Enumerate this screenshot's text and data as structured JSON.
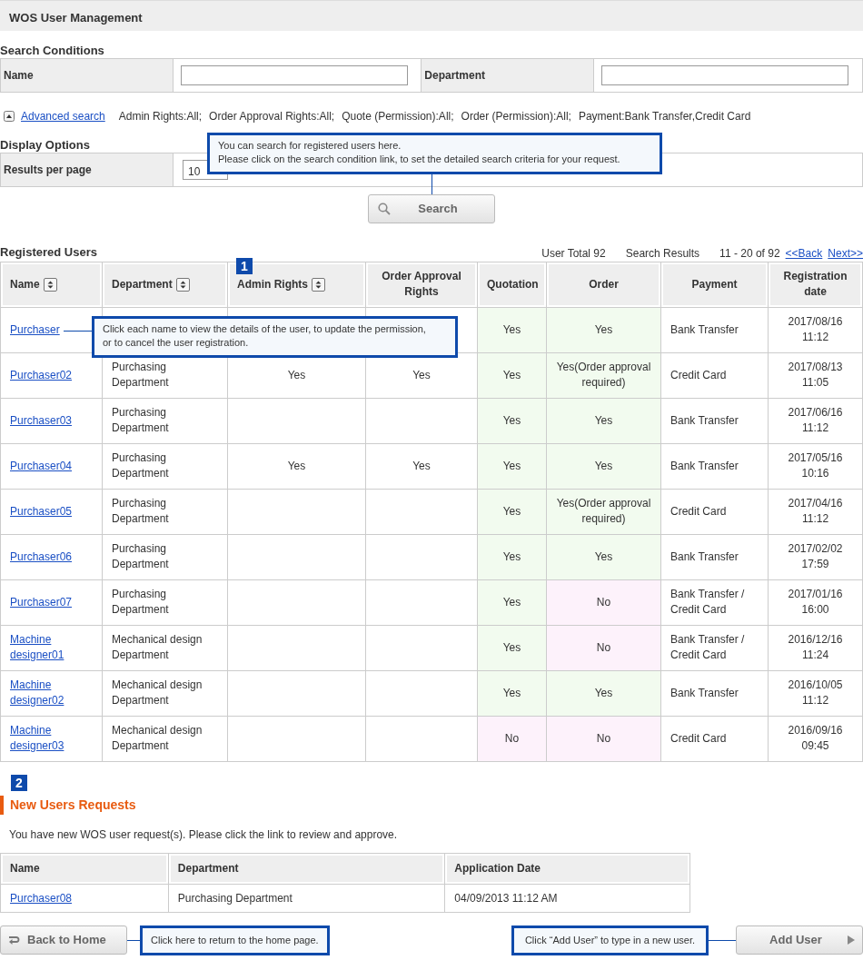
{
  "page_title": "WOS User Management",
  "search": {
    "heading": "Search Conditions",
    "fields": [
      {
        "label": "Name"
      },
      {
        "label": "Department"
      }
    ],
    "advanced_link": "Advanced search",
    "expanded": true,
    "criteria": [
      "Admin Rights:All;",
      "Order Approval Rights:All;",
      "Quote (Permission):All;",
      "Order (Permission):All;",
      "Payment:Bank Transfer,Credit Card"
    ]
  },
  "display_options": {
    "heading": "Display Options",
    "label": "Results per page",
    "value": "10"
  },
  "search_button": "Search",
  "search_callout": [
    "You can search for registered users here.",
    "Please click on the search condition link, to set the detailed search criteria for your request."
  ],
  "users": {
    "heading": "Registered Users",
    "total": "User Total 92",
    "results_label": "Search Results",
    "range": "11 - 20 of 92",
    "prev": "<<Back",
    "next": "Next>>",
    "marker": "1",
    "columns": [
      {
        "label": "Name",
        "sortable": true
      },
      {
        "label": "Department",
        "sortable": true
      },
      {
        "label": "Admin Rights",
        "sortable": true
      },
      {
        "label": "Order Approval Rights",
        "sortable": false
      },
      {
        "label": "Quotation",
        "sortable": false
      },
      {
        "label": "Order",
        "sortable": false
      },
      {
        "label": "Payment",
        "sortable": false
      },
      {
        "label": "Registration date",
        "sortable": false
      }
    ],
    "rows": [
      {
        "name": "Purchaser",
        "department": "",
        "admin": "",
        "approval": "",
        "quotation": {
          "text": "Yes",
          "granted": true
        },
        "order": {
          "text": "Yes",
          "granted": true
        },
        "payment": "Bank Transfer",
        "date": "2017/08/16 11:12"
      },
      {
        "name": "Purchaser02",
        "department": "Purchasing Department",
        "admin": "Yes",
        "approval": "Yes",
        "quotation": {
          "text": "Yes",
          "granted": true
        },
        "order": {
          "text": "Yes(Order approval required)",
          "granted": true
        },
        "payment": "Credit Card",
        "date": "2017/08/13 11:05"
      },
      {
        "name": "Purchaser03",
        "department": "Purchasing Department",
        "admin": "",
        "approval": "",
        "quotation": {
          "text": "Yes",
          "granted": true
        },
        "order": {
          "text": "Yes",
          "granted": true
        },
        "payment": "Bank Transfer",
        "date": "2017/06/16 11:12"
      },
      {
        "name": "Purchaser04",
        "department": "Purchasing Department",
        "admin": "Yes",
        "approval": "Yes",
        "quotation": {
          "text": "Yes",
          "granted": true
        },
        "order": {
          "text": "Yes",
          "granted": true
        },
        "payment": "Bank Transfer",
        "date": "2017/05/16 10:16"
      },
      {
        "name": "Purchaser05",
        "department": "Purchasing Department",
        "admin": "",
        "approval": "",
        "quotation": {
          "text": "Yes",
          "granted": true
        },
        "order": {
          "text": "Yes(Order approval required)",
          "granted": true
        },
        "payment": "Credit Card",
        "date": "2017/04/16 11:12"
      },
      {
        "name": "Purchaser06",
        "department": "Purchasing Department",
        "admin": "",
        "approval": "",
        "quotation": {
          "text": "Yes",
          "granted": true
        },
        "order": {
          "text": "Yes",
          "granted": true
        },
        "payment": "Bank Transfer",
        "date": "2017/02/02 17:59"
      },
      {
        "name": "Purchaser07",
        "department": "Purchasing Department",
        "admin": "",
        "approval": "",
        "quotation": {
          "text": "Yes",
          "granted": true
        },
        "order": {
          "text": "No",
          "granted": false
        },
        "payment": "Bank Transfer / Credit Card",
        "date": "2017/01/16 16:00"
      },
      {
        "name": "Machine designer01",
        "department": "Mechanical design Department",
        "admin": "",
        "approval": "",
        "quotation": {
          "text": "Yes",
          "granted": true
        },
        "order": {
          "text": "No",
          "granted": false
        },
        "payment": "Bank Transfer / Credit Card",
        "date": "2016/12/16 11:24"
      },
      {
        "name": "Machine designer02",
        "department": "Mechanical design Department",
        "admin": "",
        "approval": "",
        "quotation": {
          "text": "Yes",
          "granted": true
        },
        "order": {
          "text": "Yes",
          "granted": true
        },
        "payment": "Bank Transfer",
        "date": "2016/10/05 11:12"
      },
      {
        "name": "Machine designer03",
        "department": "Mechanical design Department",
        "admin": "",
        "approval": "",
        "quotation": {
          "text": "No",
          "granted": false
        },
        "order": {
          "text": "No",
          "granted": false
        },
        "payment": "Credit Card",
        "date": "2016/09/16 09:45"
      }
    ],
    "name_callout": [
      "Click each name to view the details of the user, to update the permission,",
      "or to cancel the user registration."
    ]
  },
  "requests": {
    "marker": "2",
    "heading": "New Users Requests",
    "note": "You have new WOS user request(s). Please click the link to review and approve.",
    "columns": [
      "Name",
      "Department",
      "Application Date"
    ],
    "rows": [
      {
        "name": "Purchaser08",
        "department": "Purchasing Department",
        "date": "04/09/2013 11:12 AM"
      }
    ]
  },
  "footer": {
    "back_button": "Back to Home",
    "back_callout": "Click here to return to the home page.",
    "add_callout": "Click “Add User” to type in a new user.",
    "add_button": "Add User"
  }
}
